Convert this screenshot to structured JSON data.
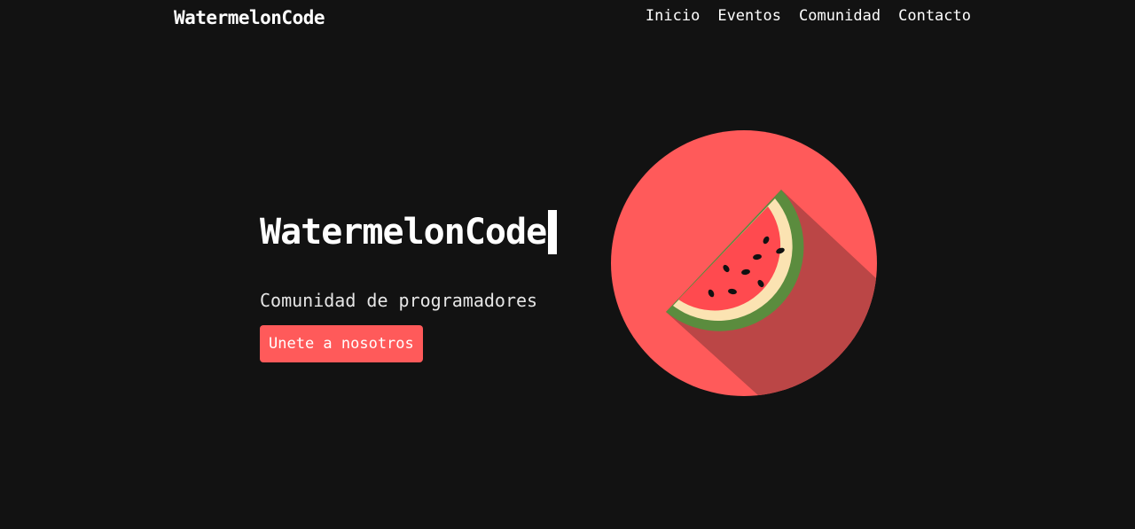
{
  "navbar": {
    "brand": "WatermelonCode",
    "links": [
      {
        "label": "Inicio"
      },
      {
        "label": "Eventos"
      },
      {
        "label": "Comunidad"
      },
      {
        "label": "Contacto"
      }
    ]
  },
  "hero": {
    "title": "WatermelonCode",
    "subtitle": "Comunidad de programadores",
    "cta_label": "Unete a nosotros",
    "image_icon": "watermelon-slice-icon"
  },
  "colors": {
    "background": "#121212",
    "accent": "#ff5a5a",
    "shadow": "#bb4646",
    "rind_dark": "#5b8c3e",
    "rind_light": "#fbe3b2",
    "flesh": "#ff4a4f",
    "seed": "#111111"
  }
}
